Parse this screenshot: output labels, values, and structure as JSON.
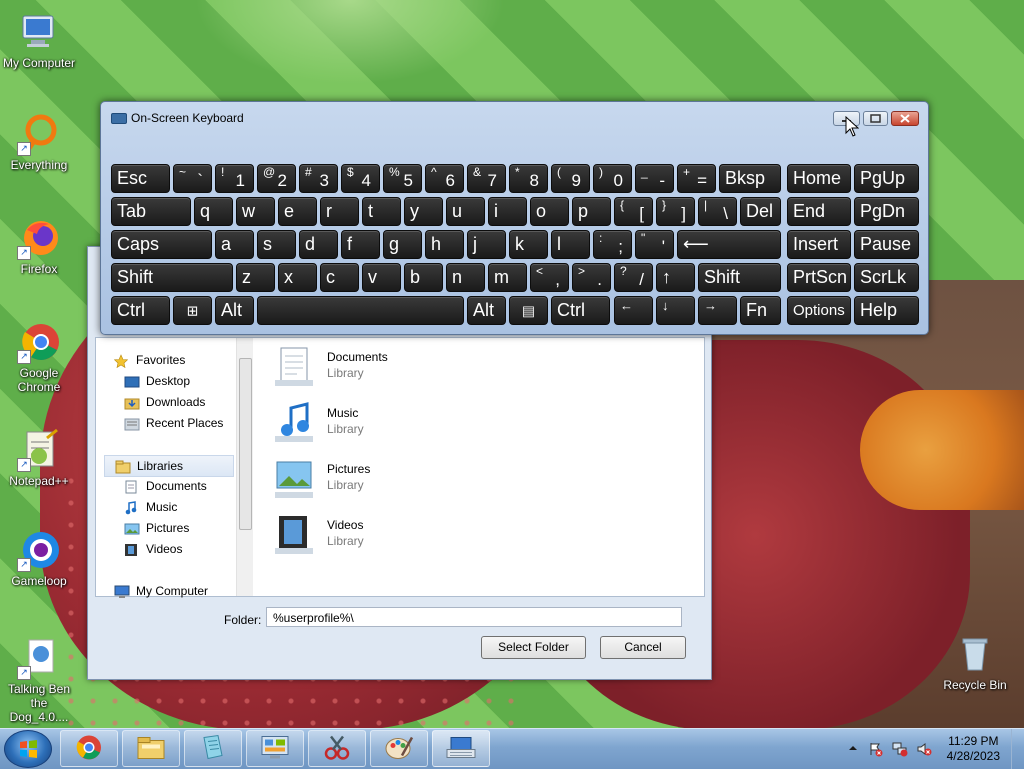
{
  "desktop": {
    "icons": [
      {
        "label": "My Computer",
        "icon": "computer-icon"
      },
      {
        "label": "Everything",
        "icon": "search-ring-icon"
      },
      {
        "label": "Firefox",
        "icon": "firefox-icon"
      },
      {
        "label": "Google Chrome",
        "icon": "chrome-icon"
      },
      {
        "label": "Notepad++",
        "icon": "notepadpp-icon"
      },
      {
        "label": "Gameloop",
        "icon": "gameloop-icon"
      },
      {
        "label": "Talking Ben the Dog_4.0....",
        "icon": "app-icon"
      },
      {
        "label": "Recycle Bin",
        "icon": "recycle-bin-icon"
      }
    ]
  },
  "dialog": {
    "nav": {
      "favorites": "Favorites",
      "desktop": "Desktop",
      "downloads": "Downloads",
      "recent": "Recent Places",
      "libraries": "Libraries",
      "documents": "Documents",
      "music": "Music",
      "pictures": "Pictures",
      "videos": "Videos",
      "computer": "My Computer"
    },
    "items": [
      {
        "name": "Documents",
        "sub": "Library"
      },
      {
        "name": "Music",
        "sub": "Library"
      },
      {
        "name": "Pictures",
        "sub": "Library"
      },
      {
        "name": "Videos",
        "sub": "Library"
      }
    ],
    "folder_label": "Folder:",
    "folder_value": "%userprofile%\\",
    "select_button": "Select Folder",
    "cancel_button": "Cancel"
  },
  "osk": {
    "title": "On-Screen Keyboard",
    "keys": {
      "esc": "Esc",
      "tilde_up": "~",
      "tilde_lo": "`",
      "k1_up": "!",
      "k1": "1",
      "k2_up": "@",
      "k2": "2",
      "k3_up": "#",
      "k3": "3",
      "k4_up": "$",
      "k4": "4",
      "k5_up": "%",
      "k5": "5",
      "k6_up": "^",
      "k6": "6",
      "k7_up": "&",
      "k7": "7",
      "k8_up": "*",
      "k8": "8",
      "k9_up": "(",
      "k9": "9",
      "k0_up": ")",
      "k0": "0",
      "minus_up": "_",
      "minus": "-",
      "plus_up": "+",
      "plus": "=",
      "bksp": "Bksp",
      "home": "Home",
      "pgup": "PgUp",
      "tab": "Tab",
      "q": "q",
      "w": "w",
      "e": "e",
      "r": "r",
      "t": "t",
      "y": "y",
      "u": "u",
      "i": "i",
      "o": "o",
      "p": "p",
      "lbr_up": "{",
      "lbr": "[",
      "rbr_up": "}",
      "rbr": "]",
      "bs_up": "|",
      "bs": "\\",
      "del": "Del",
      "end": "End",
      "pgdn": "PgDn",
      "caps": "Caps",
      "a": "a",
      "s": "s",
      "d": "d",
      "f": "f",
      "g": "g",
      "h": "h",
      "j": "j",
      "k": "k",
      "l": "l",
      "semi_up": ":",
      "semi": ";",
      "quote_up": "\"",
      "quote": "'",
      "enter": "⟵",
      "insert": "Insert",
      "pause": "Pause",
      "shift": "Shift",
      "z": "z",
      "x": "x",
      "c": "c",
      "v": "v",
      "b": "b",
      "n": "n",
      "m": "m",
      "comma_up": "<",
      "comma": ",",
      "period_up": ">",
      "period": ".",
      "slash_up": "?",
      "slash": "/",
      "up": "↑",
      "shift_r": "Shift",
      "prtscn": "PrtScn",
      "scrlk": "ScrLk",
      "ctrl": "Ctrl",
      "win": "⊞",
      "alt": "Alt",
      "alt_r": "Alt",
      "menu": "▤",
      "ctrl_r": "Ctrl",
      "left": "←",
      "down": "↓",
      "right": "→",
      "fn": "Fn",
      "options": "Options",
      "help": "Help"
    }
  },
  "taskbar": {
    "time": "11:29 PM",
    "date": "4/28/2023",
    "buttons": [
      "chrome-icon",
      "explorer-icon",
      "notepad-icon",
      "control-panel-icon",
      "snipping-icon",
      "paint-icon",
      "keyboard-icon"
    ]
  }
}
